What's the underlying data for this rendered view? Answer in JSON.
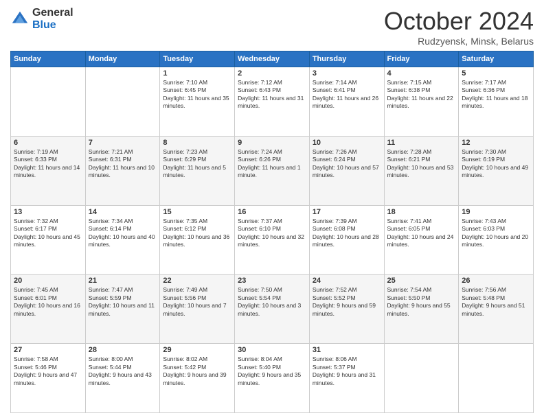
{
  "header": {
    "logo": {
      "general": "General",
      "blue": "Blue"
    },
    "title": "October 2024",
    "location": "Rudzyensk, Minsk, Belarus"
  },
  "weekdays": [
    "Sunday",
    "Monday",
    "Tuesday",
    "Wednesday",
    "Thursday",
    "Friday",
    "Saturday"
  ],
  "rows": [
    {
      "style": "normal",
      "cells": [
        {
          "day": "",
          "info": ""
        },
        {
          "day": "",
          "info": ""
        },
        {
          "day": "1",
          "info": "Sunrise: 7:10 AM\nSunset: 6:45 PM\nDaylight: 11 hours and 35 minutes."
        },
        {
          "day": "2",
          "info": "Sunrise: 7:12 AM\nSunset: 6:43 PM\nDaylight: 11 hours and 31 minutes."
        },
        {
          "day": "3",
          "info": "Sunrise: 7:14 AM\nSunset: 6:41 PM\nDaylight: 11 hours and 26 minutes."
        },
        {
          "day": "4",
          "info": "Sunrise: 7:15 AM\nSunset: 6:38 PM\nDaylight: 11 hours and 22 minutes."
        },
        {
          "day": "5",
          "info": "Sunrise: 7:17 AM\nSunset: 6:36 PM\nDaylight: 11 hours and 18 minutes."
        }
      ]
    },
    {
      "style": "alt",
      "cells": [
        {
          "day": "6",
          "info": "Sunrise: 7:19 AM\nSunset: 6:33 PM\nDaylight: 11 hours and 14 minutes."
        },
        {
          "day": "7",
          "info": "Sunrise: 7:21 AM\nSunset: 6:31 PM\nDaylight: 11 hours and 10 minutes."
        },
        {
          "day": "8",
          "info": "Sunrise: 7:23 AM\nSunset: 6:29 PM\nDaylight: 11 hours and 5 minutes."
        },
        {
          "day": "9",
          "info": "Sunrise: 7:24 AM\nSunset: 6:26 PM\nDaylight: 11 hours and 1 minute."
        },
        {
          "day": "10",
          "info": "Sunrise: 7:26 AM\nSunset: 6:24 PM\nDaylight: 10 hours and 57 minutes."
        },
        {
          "day": "11",
          "info": "Sunrise: 7:28 AM\nSunset: 6:21 PM\nDaylight: 10 hours and 53 minutes."
        },
        {
          "day": "12",
          "info": "Sunrise: 7:30 AM\nSunset: 6:19 PM\nDaylight: 10 hours and 49 minutes."
        }
      ]
    },
    {
      "style": "normal",
      "cells": [
        {
          "day": "13",
          "info": "Sunrise: 7:32 AM\nSunset: 6:17 PM\nDaylight: 10 hours and 45 minutes."
        },
        {
          "day": "14",
          "info": "Sunrise: 7:34 AM\nSunset: 6:14 PM\nDaylight: 10 hours and 40 minutes."
        },
        {
          "day": "15",
          "info": "Sunrise: 7:35 AM\nSunset: 6:12 PM\nDaylight: 10 hours and 36 minutes."
        },
        {
          "day": "16",
          "info": "Sunrise: 7:37 AM\nSunset: 6:10 PM\nDaylight: 10 hours and 32 minutes."
        },
        {
          "day": "17",
          "info": "Sunrise: 7:39 AM\nSunset: 6:08 PM\nDaylight: 10 hours and 28 minutes."
        },
        {
          "day": "18",
          "info": "Sunrise: 7:41 AM\nSunset: 6:05 PM\nDaylight: 10 hours and 24 minutes."
        },
        {
          "day": "19",
          "info": "Sunrise: 7:43 AM\nSunset: 6:03 PM\nDaylight: 10 hours and 20 minutes."
        }
      ]
    },
    {
      "style": "alt",
      "cells": [
        {
          "day": "20",
          "info": "Sunrise: 7:45 AM\nSunset: 6:01 PM\nDaylight: 10 hours and 16 minutes."
        },
        {
          "day": "21",
          "info": "Sunrise: 7:47 AM\nSunset: 5:59 PM\nDaylight: 10 hours and 11 minutes."
        },
        {
          "day": "22",
          "info": "Sunrise: 7:49 AM\nSunset: 5:56 PM\nDaylight: 10 hours and 7 minutes."
        },
        {
          "day": "23",
          "info": "Sunrise: 7:50 AM\nSunset: 5:54 PM\nDaylight: 10 hours and 3 minutes."
        },
        {
          "day": "24",
          "info": "Sunrise: 7:52 AM\nSunset: 5:52 PM\nDaylight: 9 hours and 59 minutes."
        },
        {
          "day": "25",
          "info": "Sunrise: 7:54 AM\nSunset: 5:50 PM\nDaylight: 9 hours and 55 minutes."
        },
        {
          "day": "26",
          "info": "Sunrise: 7:56 AM\nSunset: 5:48 PM\nDaylight: 9 hours and 51 minutes."
        }
      ]
    },
    {
      "style": "normal",
      "cells": [
        {
          "day": "27",
          "info": "Sunrise: 7:58 AM\nSunset: 5:46 PM\nDaylight: 9 hours and 47 minutes."
        },
        {
          "day": "28",
          "info": "Sunrise: 8:00 AM\nSunset: 5:44 PM\nDaylight: 9 hours and 43 minutes."
        },
        {
          "day": "29",
          "info": "Sunrise: 8:02 AM\nSunset: 5:42 PM\nDaylight: 9 hours and 39 minutes."
        },
        {
          "day": "30",
          "info": "Sunrise: 8:04 AM\nSunset: 5:40 PM\nDaylight: 9 hours and 35 minutes."
        },
        {
          "day": "31",
          "info": "Sunrise: 8:06 AM\nSunset: 5:37 PM\nDaylight: 9 hours and 31 minutes."
        },
        {
          "day": "",
          "info": ""
        },
        {
          "day": "",
          "info": ""
        }
      ]
    }
  ]
}
